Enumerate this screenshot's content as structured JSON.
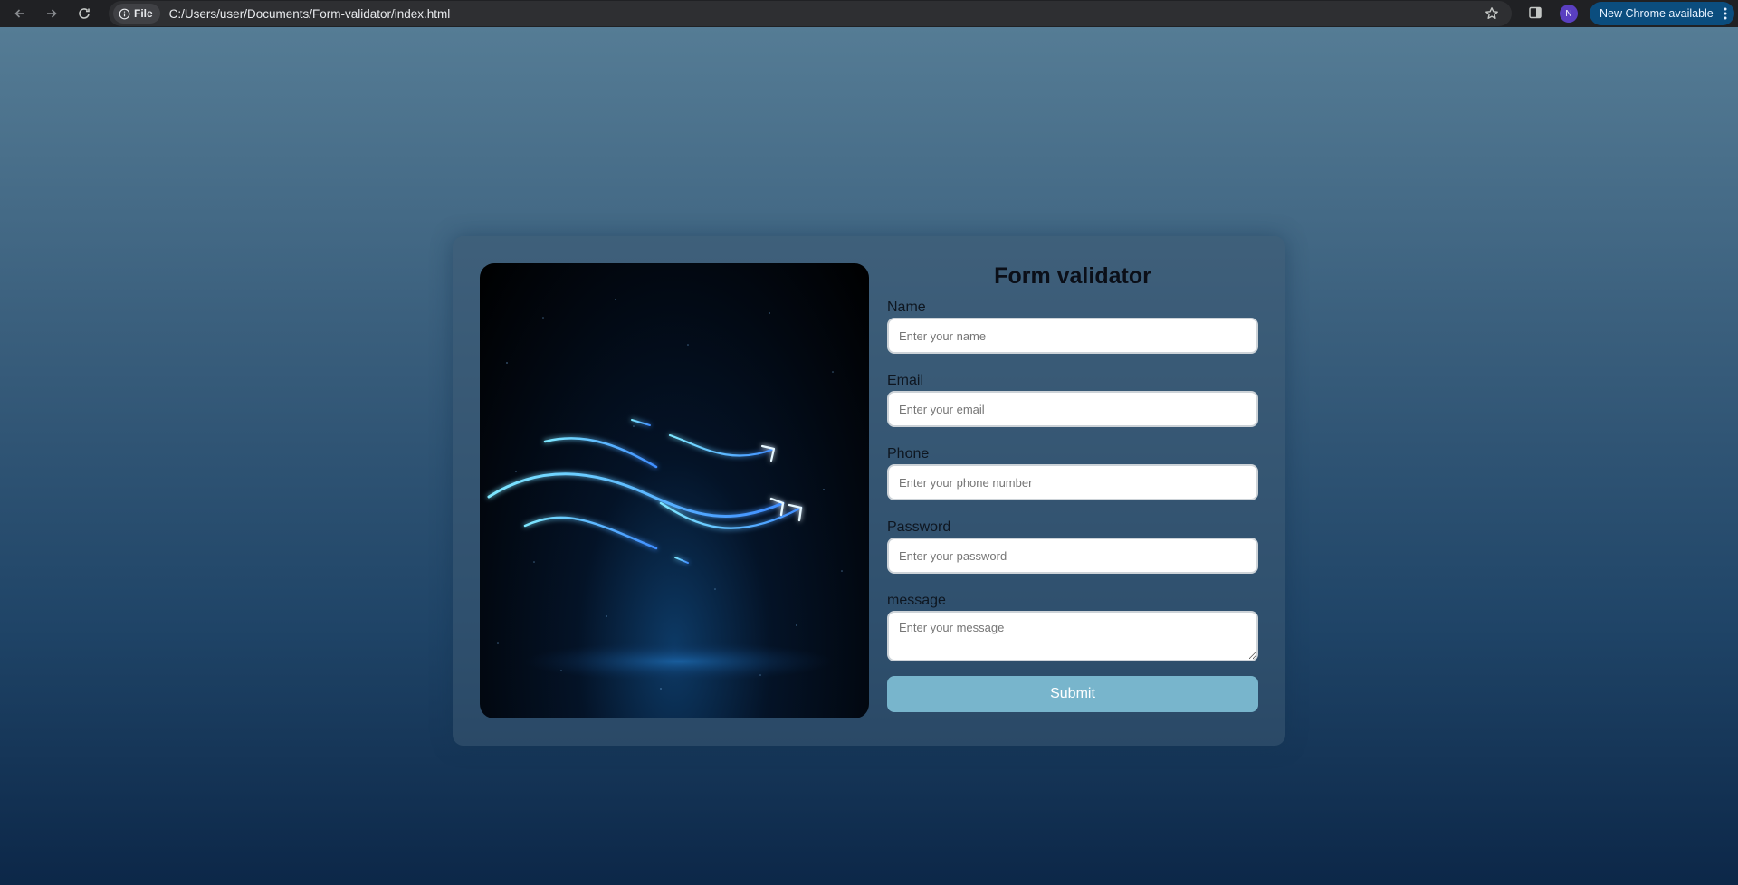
{
  "browser": {
    "chip_label": "File",
    "url": "C:/Users/user/Documents/Form-validator/index.html",
    "avatar_letter": "N",
    "update_label": "New Chrome available"
  },
  "form": {
    "title": "Form validator",
    "fields": [
      {
        "label": "Name",
        "placeholder": "Enter your name"
      },
      {
        "label": "Email",
        "placeholder": "Enter your email"
      },
      {
        "label": "Phone",
        "placeholder": "Enter your phone number"
      },
      {
        "label": "Password",
        "placeholder": "Enter your password"
      }
    ],
    "message": {
      "label": "message",
      "placeholder": "Enter your message"
    },
    "submit_label": "Submit"
  },
  "colors": {
    "submit_bg": "#78b5cc",
    "update_pill_bg": "#0b4d7e",
    "avatar_bg": "#5a3fc0"
  },
  "icons": [
    "back-arrow-icon",
    "forward-arrow-icon",
    "reload-icon",
    "info-icon",
    "star-icon",
    "side-panel-icon",
    "more-vert-icon"
  ]
}
